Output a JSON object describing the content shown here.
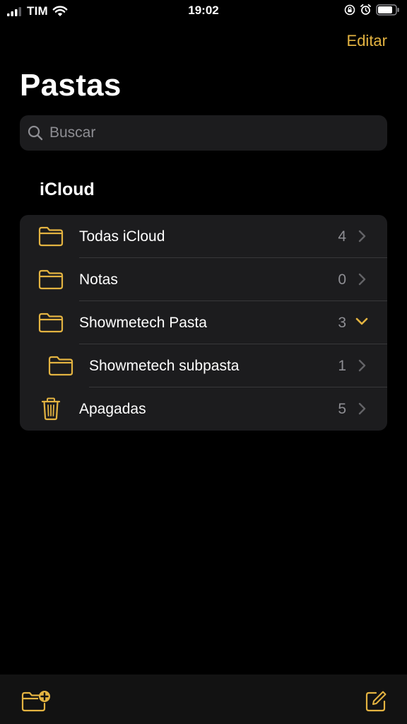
{
  "status_bar": {
    "carrier": "TIM",
    "time": "19:02"
  },
  "header": {
    "edit_label": "Editar",
    "title": "Pastas"
  },
  "search": {
    "placeholder": "Buscar",
    "icon": "search-icon"
  },
  "section": {
    "title": "iCloud"
  },
  "folders": [
    {
      "label": "Todas iCloud",
      "count": "4",
      "icon": "folder-icon",
      "chevron": "right"
    },
    {
      "label": "Notas",
      "count": "0",
      "icon": "folder-icon",
      "chevron": "right"
    },
    {
      "label": "Showmetech Pasta",
      "count": "3",
      "icon": "folder-icon",
      "chevron": "down"
    },
    {
      "label": "Showmetech subpasta",
      "count": "1",
      "icon": "folder-icon",
      "chevron": "right",
      "subfolder": true
    },
    {
      "label": "Apagadas",
      "count": "5",
      "icon": "trash-icon",
      "chevron": "right"
    }
  ],
  "toolbar": {
    "left_icon": "new-folder-icon",
    "right_icon": "compose-icon"
  },
  "colors": {
    "accent": "#E3B341",
    "background": "#000000",
    "card": "#1C1C1E",
    "secondary_text": "#8E8E93"
  }
}
